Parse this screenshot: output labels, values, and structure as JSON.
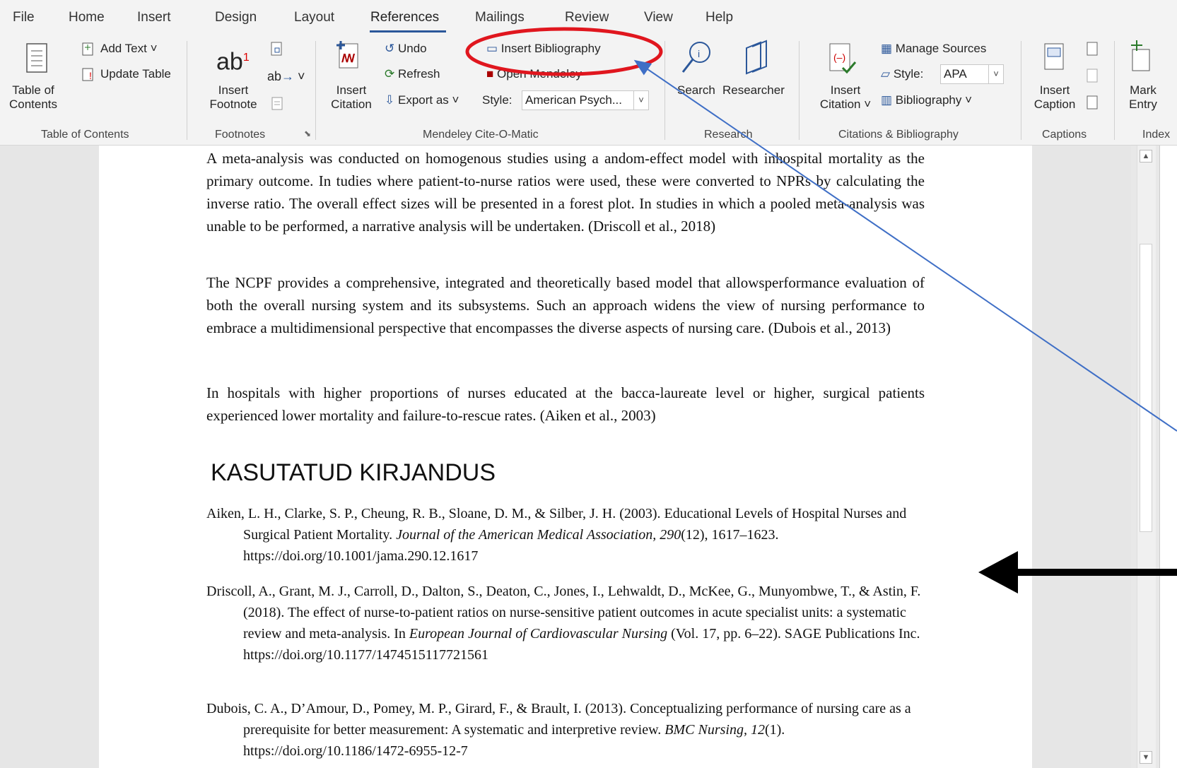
{
  "menu_tabs": [
    "File",
    "Home",
    "Insert",
    "Design",
    "Layout",
    "References",
    "Mailings",
    "Review",
    "View",
    "Help"
  ],
  "active_tab": "References",
  "ribbon": {
    "toc": {
      "table_of_contents": "Table of\nContents",
      "add_text": "Add Text",
      "update_table": "Update Table",
      "group": "Table of Contents"
    },
    "footnotes": {
      "insert_footnote": "Insert\nFootnote",
      "ab_label": "ab",
      "sup": "1",
      "group": "Footnotes"
    },
    "mendeley": {
      "insert_citation": "Insert\nCitation",
      "undo": "Undo",
      "refresh": "Refresh",
      "export_as": "Export as",
      "insert_bibliography": "Insert Bibliography",
      "open_mendeley": "Open Mendeley",
      "style_label": "Style:",
      "style_value": "American Psych...",
      "group": "Mendeley Cite-O-Matic"
    },
    "research": {
      "search": "Search",
      "researcher": "Researcher",
      "group": "Research"
    },
    "citations": {
      "insert_citation": "Insert\nCitation",
      "manage_sources": "Manage Sources",
      "style_label": "Style:",
      "style_value": "APA",
      "bibliography": "Bibliography",
      "group": "Citations & Bibliography"
    },
    "captions": {
      "insert_caption": "Insert\nCaption",
      "group": "Captions"
    },
    "index": {
      "mark_entry": "Mark\nEntry",
      "group": "Index"
    }
  },
  "document": {
    "paragraphs": [
      "A meta-analysis was conducted on homogenous studies using a andom-effect model with inhospital mortality as the primary outcome. In tudies where patient-to-nurse ratios were used, these were converted to NPRs by calculating the inverse ratio. The overall effect sizes will be presented in a forest plot. In studies in which a pooled meta-analysis was unable to be performed, a narrative analysis will be undertaken. (Driscoll et al., 2018)",
      "The NCPF provides a comprehensive, integrated and theoretically based model that allowsperformance evaluation of both the overall nursing system and its subsystems. Such an approach widens the view of nursing performance to embrace a multidimensional perspective that encompasses the diverse aspects of nursing care. (Dubois et al., 2013)",
      "In hospitals with higher proportions of nurses educated at the bacca-laureate level or higher, surgical patients experienced lower mortality and failure-to-rescue rates. (Aiken et al., 2003)"
    ],
    "heading": "KASUTATUD KIRJANDUS",
    "references": [
      {
        "pre": "Aiken, L. H., Clarke, S. P., Cheung, R. B., Sloane, D. M., & Silber, J. H. (2003). Educational Levels of Hospital Nurses and Surgical Patient Mortality. ",
        "ital": "Journal of the American Medical Association, 290",
        "post": "(12), 1617–1623. https://doi.org/10.1001/jama.290.12.1617"
      },
      {
        "pre": "Driscoll, A., Grant, M. J., Carroll, D., Dalton, S., Deaton, C., Jones, I., Lehwaldt, D., McKee, G., Munyombwe, T., & Astin, F. (2018). The effect of nurse-to-patient ratios on nurse-sensitive patient outcomes in acute specialist units: a systematic review and meta-analysis. In ",
        "ital": "European Journal of Cardiovascular Nursing",
        "post": " (Vol. 17, pp. 6–22). SAGE Publications Inc. https://doi.org/10.1177/1474515117721561"
      },
      {
        "pre": "Dubois, C. A., D’Amour, D., Pomey, M. P., Girard, F., & Brault, I. (2013). Conceptualizing performance of nursing care as a prerequisite for better measurement: A systematic and interpretive review. ",
        "ital": "BMC Nursing, 12",
        "post": "(1). https://doi.org/10.1186/1472-6955-12-7"
      }
    ]
  },
  "annotations": {
    "circle_color": "#e0161e",
    "line_color": "#3f6fc6",
    "arrow_color": "#000000"
  }
}
